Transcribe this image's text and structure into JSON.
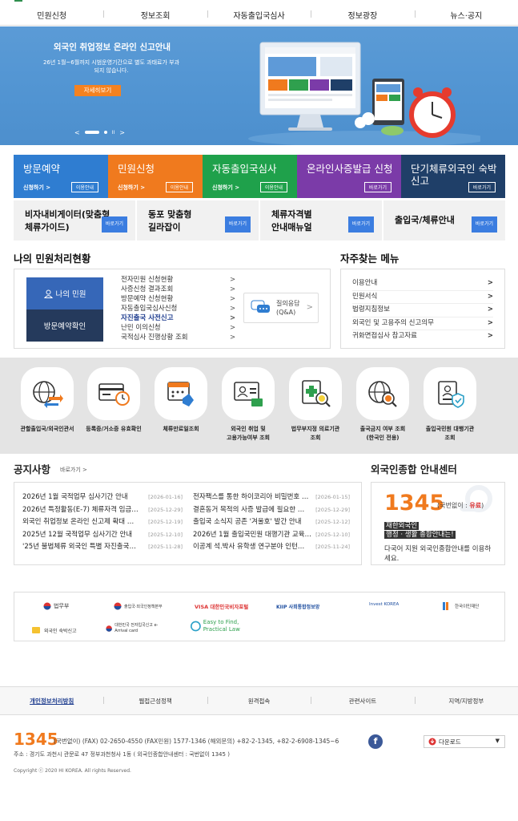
{
  "nav": {
    "items": [
      "민원신청",
      "정보조회",
      "자동출입국심사",
      "정보광장",
      "뉴스·공지"
    ]
  },
  "hero": {
    "title": "외국인 취업정보 온라인 신고안내",
    "desc_line1": "26년 1월~6월까지 시범운영기간으로 별도 과태료가 부과",
    "desc_line2": "되지 않습니다.",
    "button": "자세히보기",
    "ctrl_prev": "<",
    "ctrl_pause": "II",
    "ctrl_next": ">"
  },
  "tiles": [
    {
      "title": "방문예약",
      "sub": "신청하기 >",
      "btn": "이용안내",
      "color": "#2f7dd1"
    },
    {
      "title": "민원신청",
      "sub": "신청하기 >",
      "btn": "이용안내",
      "color": "#f07a1e"
    },
    {
      "title": "자동출입국심사",
      "sub": "신청하기 >",
      "btn": "이용안내",
      "color": "#1fa14b"
    },
    {
      "title": "온라인사증발급 신청",
      "sub": "",
      "btn": "바로가기",
      "color": "#7b3ba8"
    },
    {
      "title": "단기체류외국인 숙박신고",
      "sub": "",
      "btn": "바로가기",
      "color": "#1f3f68"
    }
  ],
  "subtiles": [
    {
      "line1": "비자내비게이터(맞춤형",
      "line2": "체류가이드)",
      "btn": "바로가기"
    },
    {
      "line1": "동포 맞춤형",
      "line2": "길라잡이",
      "btn": "바로가기"
    },
    {
      "line1": "체류자격별",
      "line2": "안내매뉴얼",
      "btn": "바로가기"
    },
    {
      "line1": "출입국/체류안내",
      "line2": "",
      "btn": "바로가기"
    }
  ],
  "status": {
    "title": "나의 민원처리현황",
    "my_btn": "나의 민원",
    "visit_btn": "방문예약확인",
    "items": [
      "전자민원 신청현황",
      "사증신청 결과조회",
      "방문예약 신청현황",
      "자동출입국심사신청",
      "자진출국 사전신고",
      "난민 이의신청",
      "국적심사 진행상황 조회"
    ],
    "active_index": 4,
    "qa_line1": "질의응답",
    "qa_line2": "(Q&A)"
  },
  "faq": {
    "title": "자주찾는 메뉴",
    "items": [
      "이용안내",
      "민원서식",
      "법령지침정보",
      "외국인 및 고용주의 신고의무",
      "귀화면접심사 참고자료"
    ]
  },
  "icons": [
    {
      "name": "globe-exchange-icon",
      "label1": "관할출입국/외국인관서",
      "label2": ""
    },
    {
      "name": "card-clock-icon",
      "label1": "등록증/거소증 유효확인",
      "label2": ""
    },
    {
      "name": "calendar-hand-icon",
      "label1": "체류만료일조회",
      "label2": ""
    },
    {
      "name": "employment-icon",
      "label1": "외국인 취업 및",
      "label2": "고용가능여부 조회"
    },
    {
      "name": "hospital-search-icon",
      "label1": "법무부지정 의료기관",
      "label2": "조회"
    },
    {
      "name": "globe-search-icon",
      "label1": "출국금지 여부 조회",
      "label2": "(한국인 전용)"
    },
    {
      "name": "proxy-shield-icon",
      "label1": "출입국민원 대행기관",
      "label2": "조회"
    }
  ],
  "notices": {
    "title": "공지사항",
    "more": "바로가기 >",
    "left": [
      {
        "t": "2026년 1월 국적업무 심사기간 안내",
        "d": "[2026-01-16]"
      },
      {
        "t": "2026년 특정활동(E-7) 체류자격 임금…",
        "d": "[2025-12-29]"
      },
      {
        "t": "외국인 취업정보 온라인 신고제 확대 …",
        "d": "[2025-12-19]"
      },
      {
        "t": "2025년 12월 국적업무 심사기간 안내",
        "d": "[2025-12-10]"
      },
      {
        "t": "'25년 불법체류 외국인 특별 자진출국…",
        "d": "[2025-11-28]"
      }
    ],
    "right": [
      {
        "t": "전자팩스를 통한 하이코리아 비밀번호 …",
        "d": "[2026-01-15]"
      },
      {
        "t": "결혼동거 목적의 사증 발급에 필요한 …",
        "d": "[2025-12-29]"
      },
      {
        "t": "출입국 소식지 공존 '겨울호' 발간 안내",
        "d": "[2025-12-12]"
      },
      {
        "t": "2026년 1월 출입국민원 대행기관 교육…",
        "d": "[2025-12-10]"
      },
      {
        "t": "이공계 석.박사 유학생 연구분야 인턴…",
        "d": "[2025-11-24]"
      }
    ]
  },
  "center": {
    "title": "외국인종합 안내센터",
    "num": "1345",
    "num_sub_prefix": "(국번없이 : ",
    "num_sub_bold": "유료",
    "num_sub_suffix": ")",
    "hl1": "재한외국인",
    "hl2": "행정 · 생활 종합안내는!",
    "desc": "다국어 지원 외국인종합안내를 이용하세요."
  },
  "partners": [
    {
      "name": "ministry-of-justice-logo",
      "text": "법무부"
    },
    {
      "name": "immigration-policy-logo",
      "text": "출입국·외국인정책본부"
    },
    {
      "name": "visa-portal-logo",
      "text": "VISA 대한민국비자포털"
    },
    {
      "name": "kiip-logo",
      "text": "KIIP 사회통합정보망"
    },
    {
      "name": "invest-korea-logo",
      "text": "Invest KOREA"
    },
    {
      "name": "korea-immigration-foundation-logo",
      "text": "한국이민재단"
    },
    {
      "name": "foreigner-lodging-logo",
      "text": "외국인 숙박신고"
    },
    {
      "name": "e-arrival-logo",
      "text": "대한민국 전자입국신고 e-Arrival card"
    },
    {
      "name": "easy-law-logo",
      "text": "Easy to Find, Practical Law"
    }
  ],
  "footer": {
    "links": [
      "개인정보처리방침",
      "웹접근성정책",
      "원격접속",
      "관련사이트",
      "지역/지방정부"
    ],
    "num": "1345",
    "row": "(국번없이)    (FAX) 02-2650-4550    (FAX민원) 1577-1346    (해외문의) +82-2-1345, +82-2-6908-1345~6",
    "addr": "주소 : 경기도 과천시 관문로 47 정부과천청사 1동 ( 외국인종합안내센터 : 국번없이 1345 )",
    "copy": "Copyright ⓒ 2020 HI KOREA. All rights Reserved.",
    "fb": "f",
    "download": "다운로드"
  },
  "colors": {
    "accent_orange": "#f07a1e",
    "hero_blue": "#5194d2",
    "status_blue": "#3667b8",
    "status_navy": "#253a5c",
    "link_blue": "#3b7de0"
  }
}
